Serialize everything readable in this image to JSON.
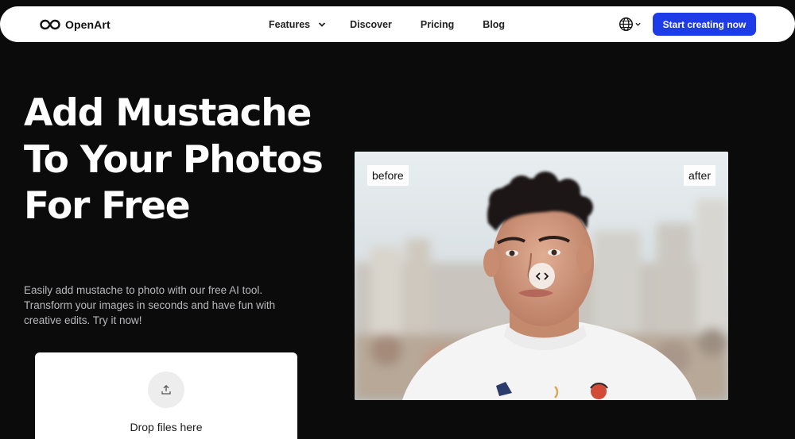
{
  "nav": {
    "brand": "OpenArt",
    "links": [
      "Features",
      "Discover",
      "Pricing",
      "Blog"
    ],
    "cta": "Start creating now"
  },
  "hero": {
    "title": "Add Mustache To Your Photos For Free",
    "subtitle": "Easily add mustache to photo with our free AI tool. Transform your images in seconds and have fun with creative edits. Try it now!"
  },
  "upload": {
    "label": "Drop files here"
  },
  "compare": {
    "before_label": "before",
    "after_label": "after"
  },
  "colors": {
    "background": "#0b0b0c",
    "accent": "#1d3be6",
    "nav_bg": "#ffffff"
  },
  "icons": {
    "logo": "infinity-logo-icon",
    "features_chevron": "chevron-down-icon",
    "language": "globe-icon",
    "upload": "upload-icon",
    "slider": "left-right-chevrons-icon"
  }
}
